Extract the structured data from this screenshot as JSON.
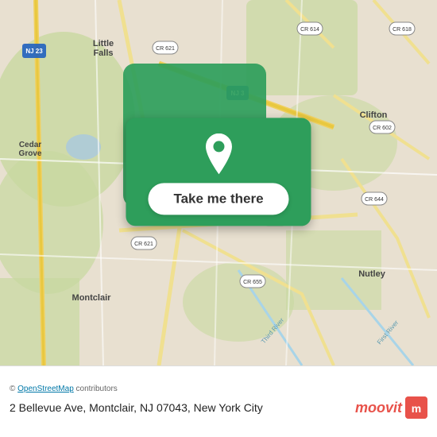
{
  "map": {
    "alt": "Map of Montclair NJ area",
    "center_lat": 40.83,
    "center_lng": -74.21
  },
  "button": {
    "label": "Take me there"
  },
  "attribution": {
    "prefix": "© ",
    "osm_link_text": "OpenStreetMap",
    "suffix": " contributors"
  },
  "address": {
    "text": "2 Bellevue Ave, Montclair, NJ 07043, New York City"
  },
  "moovit": {
    "text": "moovit",
    "icon_letter": "m"
  },
  "colors": {
    "green": "#2e9e5b",
    "white": "#ffffff",
    "moovit_red": "#e8524a"
  }
}
